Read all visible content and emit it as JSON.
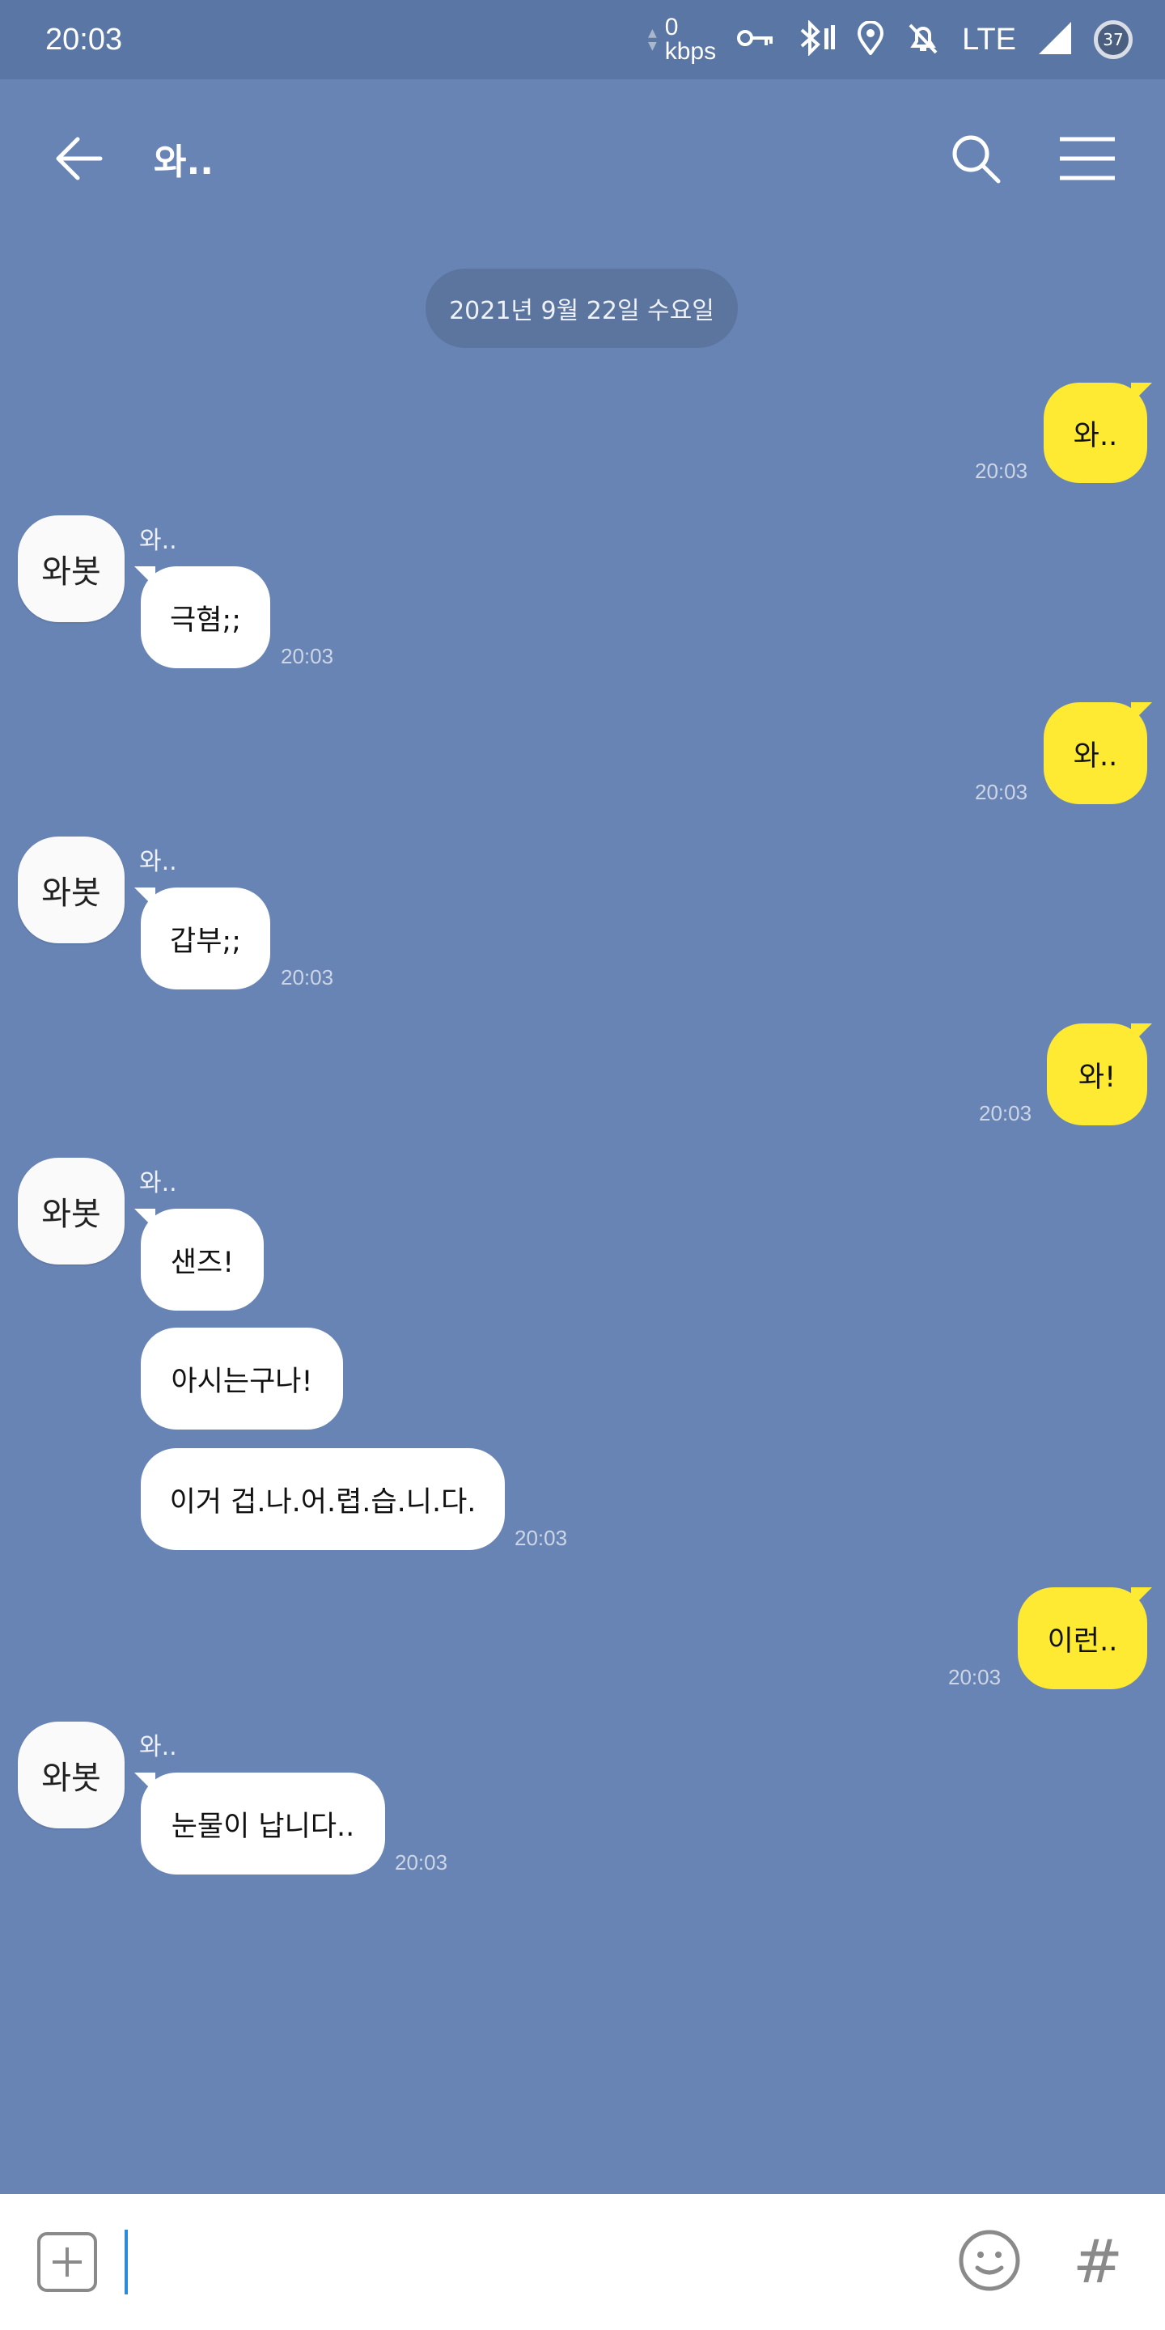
{
  "status_bar": {
    "time": "20:03",
    "rate_value": "0",
    "rate_unit": "kbps",
    "network": "LTE",
    "battery": "37",
    "icons": [
      "data-arrows-icon",
      "vpn-key-icon",
      "bluetooth-icon",
      "location-icon",
      "notifications-off-icon",
      "signal-icon",
      "battery-icon"
    ]
  },
  "header": {
    "title": "와..",
    "icons": [
      "back-arrow-icon",
      "search-icon",
      "menu-icon"
    ]
  },
  "date_label": "2021년 9월 22일 수요일",
  "messages": [
    {
      "side": "right",
      "text": "와..",
      "time": "20:03"
    },
    {
      "side": "left",
      "sender": "와..",
      "text": "극혐;;",
      "time": "20:03"
    },
    {
      "side": "right",
      "text": "와..",
      "time": "20:03"
    },
    {
      "side": "left",
      "sender": "와..",
      "text": "갑부;;",
      "time": "20:03"
    },
    {
      "side": "right",
      "text": "와!",
      "time": "20:03"
    },
    {
      "side": "left",
      "sender": "와..",
      "text": "샌즈!"
    },
    {
      "side": "left",
      "text": "아시는구나!"
    },
    {
      "side": "left",
      "text": "이거 겁.나.어.렵.습.니.다.",
      "time": "20:03"
    },
    {
      "side": "right",
      "text": "이런..",
      "time": "20:03"
    },
    {
      "side": "left",
      "sender": "와..",
      "text": "눈물이 납니다..",
      "time": "20:03"
    }
  ],
  "avatar_text": "와봇",
  "input_bar": {
    "value": "",
    "icons": [
      "plus-icon",
      "emoji-icon",
      "hashtag-icon"
    ],
    "hash_glyph": "#"
  },
  "colors": {
    "background": "#6884b4",
    "status_bar": "#5a76a4",
    "my_bubble": "#fee933",
    "their_bubble": "#ffffff",
    "date_pill": "#5b759f"
  }
}
